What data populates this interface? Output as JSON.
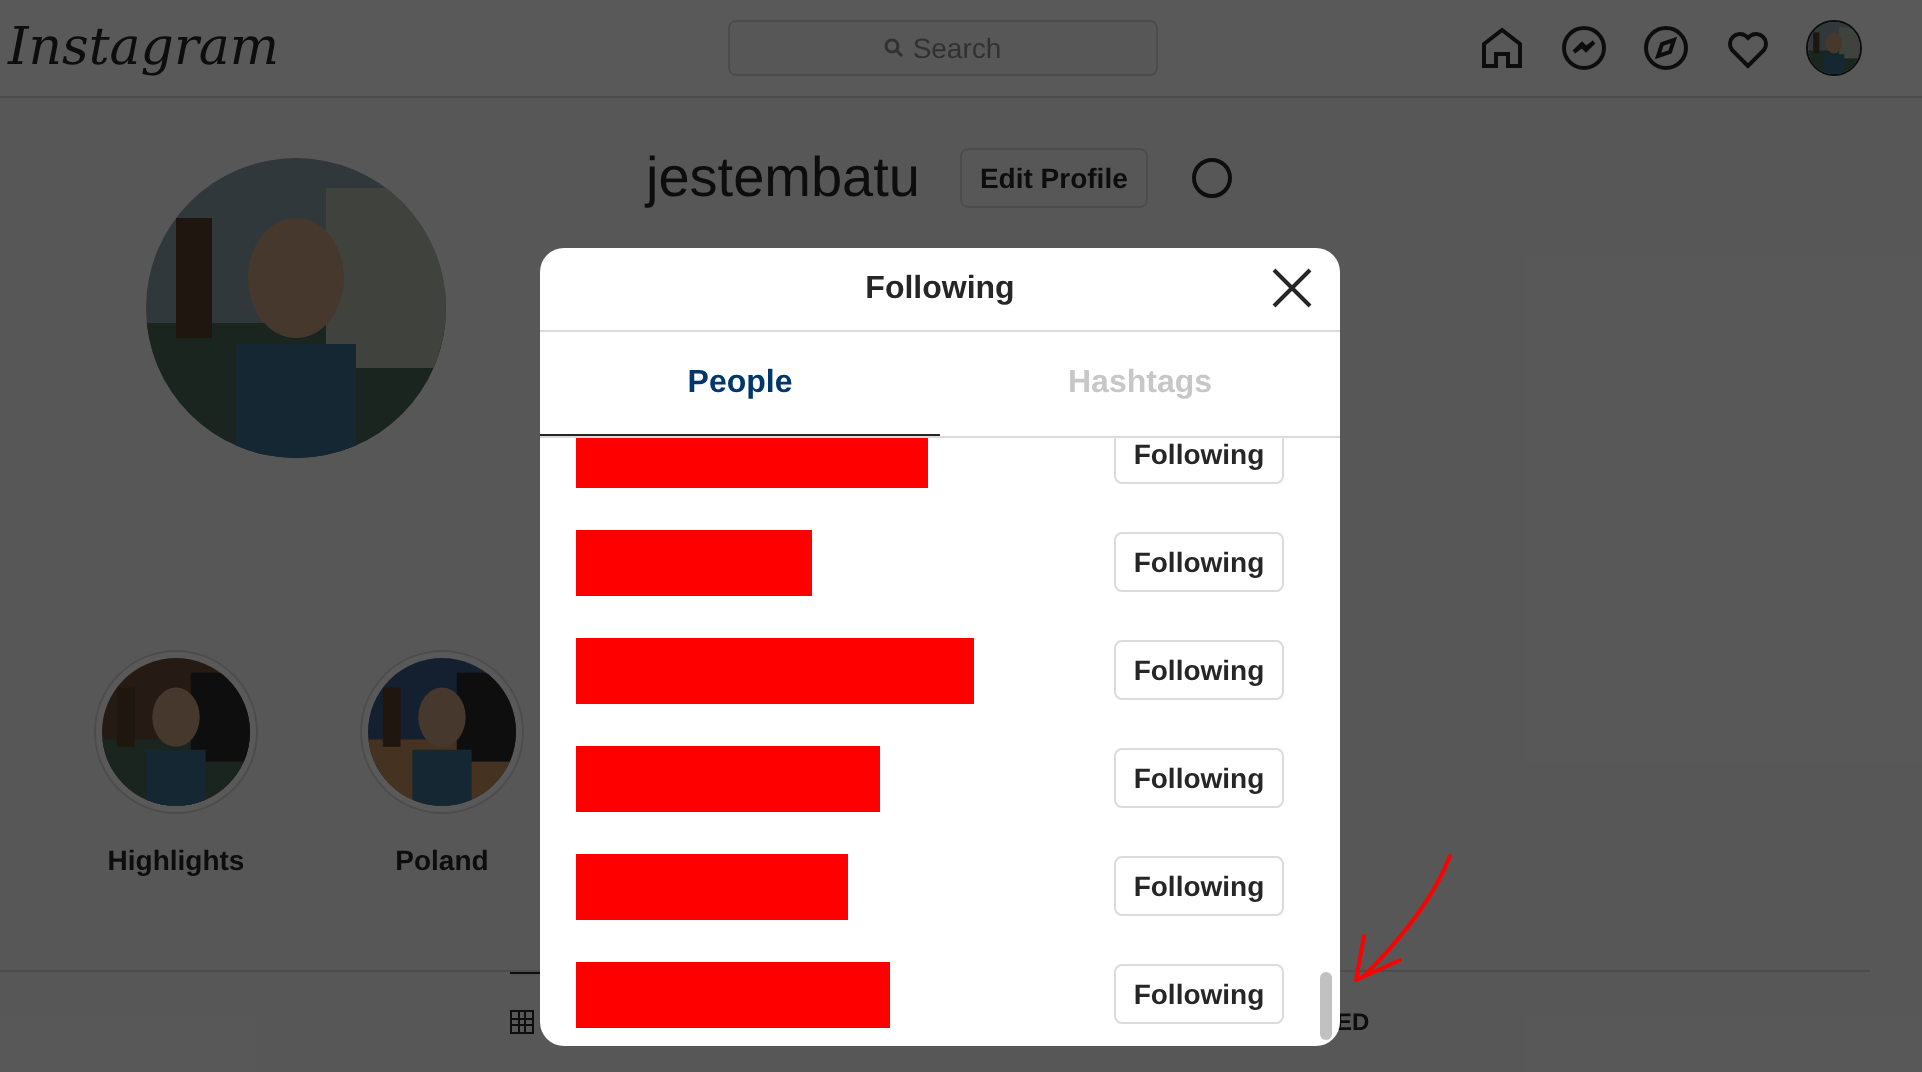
{
  "header": {
    "logo": "Instagram",
    "search": {
      "placeholder": "Search"
    }
  },
  "profile": {
    "username": "jestembatu",
    "edit_button": "Edit Profile"
  },
  "highlights": [
    {
      "label": "Highlights"
    },
    {
      "label": "Poland"
    }
  ],
  "profile_tabs": [
    {
      "kind": "icon",
      "selected": true
    },
    {
      "kind": "text",
      "label": "ED",
      "selected": false
    }
  ],
  "modal": {
    "title": "Following",
    "tabs": [
      {
        "label": "People",
        "selected": true
      },
      {
        "label": "Hashtags",
        "selected": false
      }
    ],
    "rows": [
      {
        "button": "Following"
      },
      {
        "button": "Following"
      },
      {
        "button": "Following"
      },
      {
        "button": "Following"
      },
      {
        "button": "Following"
      },
      {
        "button": "Following"
      }
    ]
  }
}
